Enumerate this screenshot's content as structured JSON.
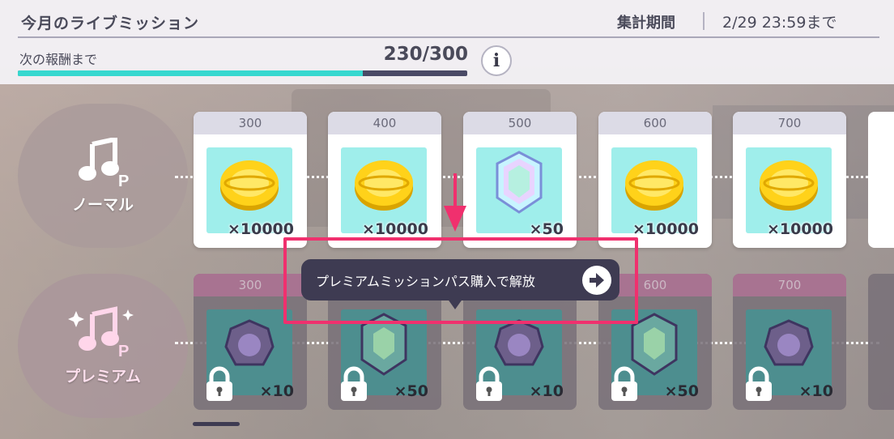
{
  "header": {
    "title": "今月のライブミッション",
    "period_label": "集計期間",
    "period_value": "2/29 23:59まで",
    "next_reward_label": "次の報酬まで",
    "progress_text": "230/300",
    "progress_fraction": 0.767,
    "info_label": "i"
  },
  "tracks": {
    "normal_label": "ノーマル",
    "premium_label": "プレミアム"
  },
  "normal_rewards": [
    {
      "points": "300",
      "item": "coin",
      "qty": "×10000"
    },
    {
      "points": "400",
      "item": "coin",
      "qty": "×10000"
    },
    {
      "points": "500",
      "item": "crystal",
      "qty": "×50"
    },
    {
      "points": "600",
      "item": "coin",
      "qty": "×10000"
    },
    {
      "points": "700",
      "item": "coin",
      "qty": "×10000"
    }
  ],
  "premium_rewards": [
    {
      "points": "300",
      "item": "gem",
      "qty": "×10",
      "locked": true
    },
    {
      "points": "",
      "item": "crystal",
      "qty": "×50",
      "locked": true
    },
    {
      "points": "",
      "item": "gem",
      "qty": "×10",
      "locked": true
    },
    {
      "points": "600",
      "item": "crystal",
      "qty": "×50",
      "locked": true
    },
    {
      "points": "700",
      "item": "gem",
      "qty": "×10",
      "locked": true
    }
  ],
  "tooltip": {
    "text": "プレミアムミッションパス購入で解放"
  },
  "colors": {
    "progress_fill": "#36d8cf",
    "progress_track": "#4a4a66",
    "highlight": "#f0306e",
    "card_bg": "#9feeeb",
    "premium_head": "#a87391"
  }
}
